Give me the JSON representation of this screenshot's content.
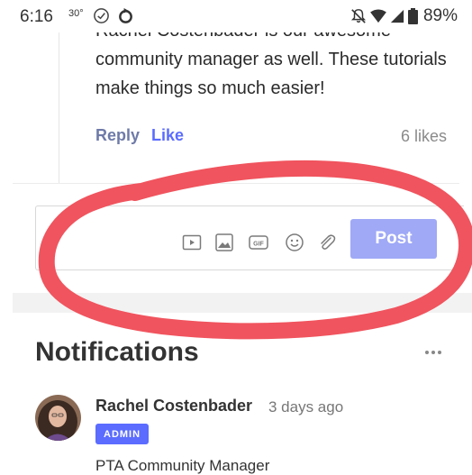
{
  "status_bar": {
    "time": "6:16",
    "temperature": "30°",
    "battery": "89%"
  },
  "comment": {
    "text": "Rachel Costenbader is our awesome community manager as well. These tutorials make things so much easier!",
    "reply_label": "Reply",
    "like_label": "Like",
    "likes": "6 likes"
  },
  "composer": {
    "post_label": "Post",
    "tools": [
      "video-icon",
      "image-icon",
      "gif-icon",
      "emoji-icon",
      "attachment-icon"
    ]
  },
  "notifications": {
    "title": "Notifications",
    "author": "Rachel Costenbader",
    "time_ago": "3 days ago",
    "badge": "ADMIN",
    "role": "PTA Community Manager"
  },
  "colors": {
    "accent": "#5b6cff",
    "post_button": "#9fa9f6",
    "annotation": "#f0545e"
  }
}
